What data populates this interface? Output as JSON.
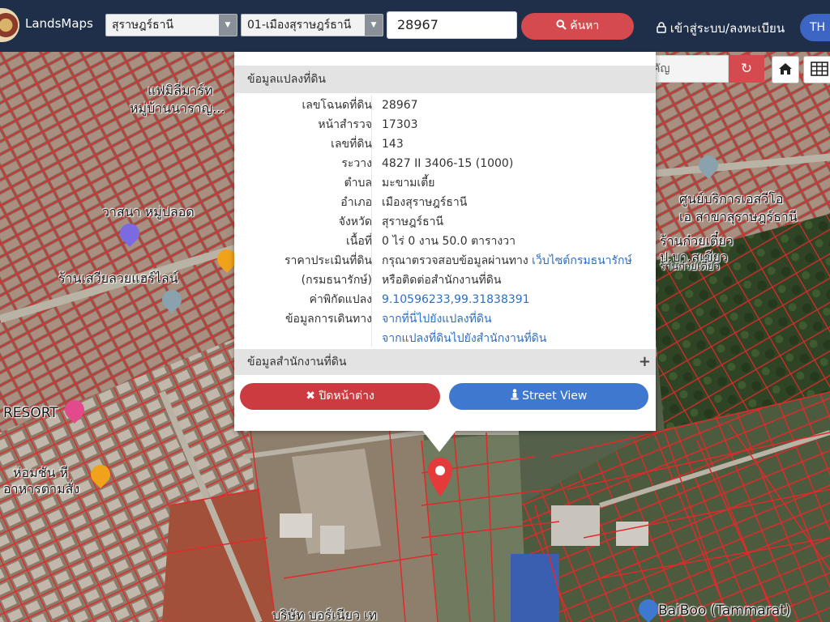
{
  "app": {
    "brand": "LandsMaps"
  },
  "topbar": {
    "province": "สุราษฎร์ธานี",
    "district": "01-เมืองสุราษฎร์ธานี",
    "parcel_search": "28967",
    "search_button": "ค้นหา",
    "login": "เข้าสู่ระบบ/ลงทะเบียน",
    "lang": "TH"
  },
  "landmark_search": {
    "placeholder": "ค้นหาสถานที่สำคัญ"
  },
  "popup": {
    "title": "ข้อมูลแปลงที่ดิน",
    "rows": [
      {
        "label": "เลขโฉนดที่ดิน",
        "value": "28967"
      },
      {
        "label": "หน้าสำรวจ",
        "value": "17303"
      },
      {
        "label": "เลขที่ดิน",
        "value": "143"
      },
      {
        "label": "ระวาง",
        "value": "4827 II 3406-15 (1000)"
      },
      {
        "label": "ตำบล",
        "value": "มะขามเตี้ย"
      },
      {
        "label": "อำเภอ",
        "value": "เมืองสุราษฎร์ธานี"
      },
      {
        "label": "จังหวัด",
        "value": "สุราษฎร์ธานี"
      },
      {
        "label": "เนื้อที่",
        "value": "0 ไร่ 0 งาน 50.0 ตารางวา"
      }
    ],
    "appraisal_label": "ราคาประเมินที่ดิน",
    "appraisal_text": "กรุณาตรวจสอบข้อมูลผ่านทาง",
    "appraisal_link": "เว็บไซต์กรมธนารักษ์",
    "treasury_label": "(กรมธนารักษ์)",
    "treasury_text": "หรือติดต่อสำนักงานที่ดิน",
    "coord_label": "ค่าพิกัดแปลง",
    "coord_value": "9.10596233,99.31838391",
    "travel_label": "ข้อมูลการเดินทาง",
    "travel_link_1": "จากที่นี่ไปยังแปลงที่ดิน",
    "travel_link_2": "จากแปลงที่ดินไปยังสำนักงานที่ดิน",
    "office_section": "ข้อมูลสำนักงานที่ดิน",
    "close_button": "ปิดหน้าต่าง",
    "street_view_button": "Street View"
  },
  "map_labels": {
    "a": "แฟมิลี่มาร์ท",
    "b": "หมู่บ้านนาราญ...",
    "c": "วาสนา หมู่ปลอด",
    "d": "ร้านเสวียลวยแฮร์ไลน์",
    "e": "RESORT",
    "f": "ห่อมชัน หี",
    "g": "อาหารตามสั่ง",
    "h": "ศูนย์บริการเอสวีโอ",
    "i": "เอ สาขาสุราษฎร์ธานี",
    "j": "ร้านก๋วยเตี๋ยว",
    "k": "ป.บา.สเขียว",
    "l": "ร้านก๋วยเตี๋ยว",
    "m": "บริษัท บอร์เนียว เท",
    "n": "BaiBoo (Tammarat)"
  },
  "colors": {
    "topbar": "#1f2f4a",
    "accent_red": "#d54a4e",
    "accent_blue": "#3f79cf",
    "parcel_line": "#e02a2a"
  }
}
